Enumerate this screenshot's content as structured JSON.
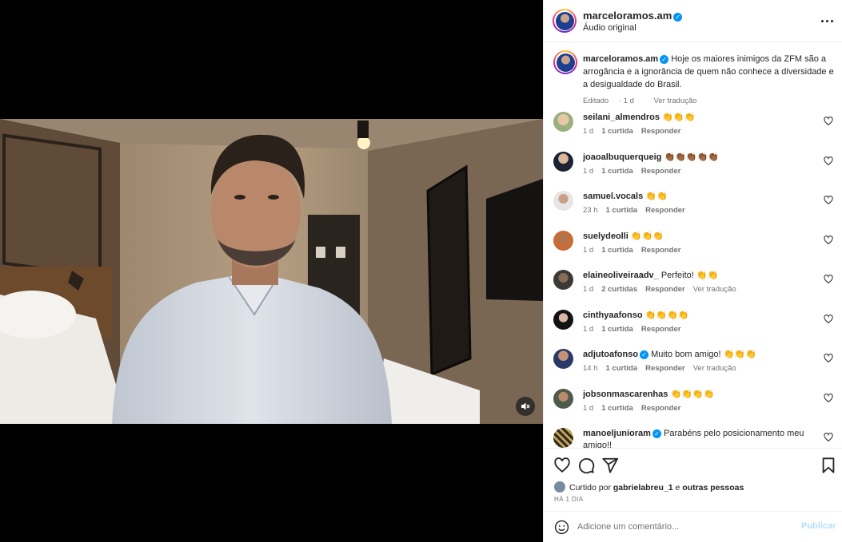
{
  "post": {
    "username": "marceloramos.am",
    "audio": "Áudio original",
    "verified_icon": "verified-badge-icon",
    "more_icon": "more-options-icon"
  },
  "caption": {
    "username": "marceloramos.am",
    "text": "Hoje os maiores inimigos da ZFM são a arrogância e a ignorância de quem não conhece a diversidade e a desigualdade do Brasil.",
    "edited": "Editado",
    "time": "1 d",
    "translate": "Ver tradução"
  },
  "comments": [
    {
      "user": "seilani_almendros",
      "verified": false,
      "text": "👏👏👏",
      "time": "1 d",
      "likes": "1 curtida",
      "reply": "Responder",
      "translate": ""
    },
    {
      "user": "joaoalbuquerqueig",
      "verified": false,
      "text": "👏🏾👏🏾👏🏾👏🏾👏🏾",
      "time": "1 d",
      "likes": "1 curtida",
      "reply": "Responder",
      "translate": ""
    },
    {
      "user": "samuel.vocals",
      "verified": false,
      "text": "👏👏",
      "time": "23 h",
      "likes": "1 curtida",
      "reply": "Responder",
      "translate": ""
    },
    {
      "user": "suelydeolli",
      "verified": false,
      "text": "👏👏👏",
      "time": "1 d",
      "likes": "1 curtida",
      "reply": "Responder",
      "translate": ""
    },
    {
      "user": "elaineoliveiraadv_",
      "verified": false,
      "text": "Perfeito! 👏👏",
      "time": "1 d",
      "likes": "2 curtidas",
      "reply": "Responder",
      "translate": "Ver tradução"
    },
    {
      "user": "cinthyaafonso",
      "verified": false,
      "text": "👏👏👏👏",
      "time": "1 d",
      "likes": "1 curtida",
      "reply": "Responder",
      "translate": ""
    },
    {
      "user": "adjutoafonso",
      "verified": true,
      "text": "Muito bom amigo! 👏👏👏",
      "time": "14 h",
      "likes": "1 curtida",
      "reply": "Responder",
      "translate": "Ver tradução"
    },
    {
      "user": "jobsonmascarenhas",
      "verified": false,
      "text": "👏👏👏👏",
      "time": "1 d",
      "likes": "1 curtida",
      "reply": "Responder",
      "translate": ""
    },
    {
      "user": "manoeljunioram",
      "verified": true,
      "text": "Parabéns pelo posicionamento meu amigo!!",
      "time": "",
      "likes": "",
      "reply": "",
      "translate": ""
    }
  ],
  "actions": {
    "liked_prefix": "Curtido por",
    "liked_user": "gabrielabreu_1",
    "liked_and": "e",
    "liked_others": "outras pessoas",
    "time_ago": "HÁ 1 DIA"
  },
  "add_comment": {
    "placeholder": "Adicione um comentário...",
    "publish": "Publicar"
  },
  "colors": {
    "accent": "#0095f6",
    "publish_disabled": "#b2dffc",
    "muted_text": "#737373"
  }
}
